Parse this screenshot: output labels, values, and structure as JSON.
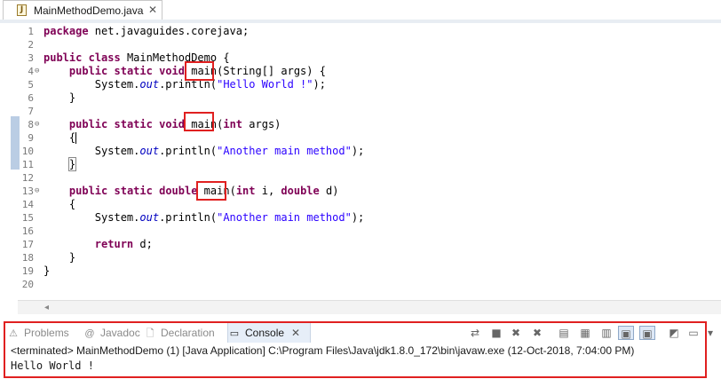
{
  "editor_tab": {
    "title": "MainMethodDemo.java",
    "icon": "java-file-icon",
    "close": "✕"
  },
  "code_lines": [
    {
      "n": "1",
      "html": "<span class=\"kw\">package</span> net.javaguides.corejava;"
    },
    {
      "n": "2",
      "html": ""
    },
    {
      "n": "3",
      "html": "<span class=\"kw\">public</span> <span class=\"kw\">class</span> MainMethodDemo {"
    },
    {
      "n": "4",
      "fold": "⊖",
      "html": "    <span class=\"kw\">public</span> <span class=\"kw\">static</span> <span class=\"kw\">void</span> main(String[] args) {"
    },
    {
      "n": "5",
      "html": "        System.<span class=\"fld\">out</span>.println(<span class=\"str\">\"Hello World !\"</span>);"
    },
    {
      "n": "6",
      "html": "    }"
    },
    {
      "n": "7",
      "html": ""
    },
    {
      "n": "8",
      "fold": "⊖",
      "html": "    <span class=\"kw\">public</span> <span class=\"kw\">static</span> <span class=\"kw\">void</span> main(<span class=\"kw\">int</span> args)"
    },
    {
      "n": "9",
      "html": "    {<span class=\"cursor\"></span>"
    },
    {
      "n": "10",
      "html": "        System.<span class=\"fld\">out</span>.println(<span class=\"str\">\"Another main method\"</span>);"
    },
    {
      "n": "11",
      "html": "    <span class=\"bracket-box\">}</span>"
    },
    {
      "n": "12",
      "html": ""
    },
    {
      "n": "13",
      "fold": "⊖",
      "html": "    <span class=\"kw\">public</span> <span class=\"kw\">static</span> <span class=\"kw\">double</span> main(<span class=\"kw\">int</span> i, <span class=\"kw\">double</span> d)"
    },
    {
      "n": "14",
      "html": "    {"
    },
    {
      "n": "15",
      "html": "        System.<span class=\"fld\">out</span>.println(<span class=\"str\">\"Another main method\"</span>);"
    },
    {
      "n": "16",
      "html": ""
    },
    {
      "n": "17",
      "html": "        <span class=\"kw\">return</span> d;"
    },
    {
      "n": "18",
      "html": "    }"
    },
    {
      "n": "19",
      "html": "}"
    },
    {
      "n": "20",
      "html": ""
    }
  ],
  "console_tabs": [
    {
      "label": "Problems",
      "icon": "problems-icon",
      "glyph": "⚠",
      "active": false
    },
    {
      "label": "Javadoc",
      "icon": "javadoc-icon",
      "glyph": "@",
      "active": false
    },
    {
      "label": "Declaration",
      "icon": "declaration-icon",
      "glyph": "🗋",
      "active": false
    },
    {
      "label": "Console",
      "icon": "console-icon",
      "glyph": "▭",
      "active": true
    }
  ],
  "console_close": "✕",
  "toolbar": [
    {
      "name": "pin-console-icon",
      "glyph": "⇄"
    },
    {
      "name": "terminate-icon",
      "glyph": "■"
    },
    {
      "name": "remove-launch-icon",
      "glyph": "✖"
    },
    {
      "name": "remove-all-terminated-icon",
      "glyph": "✖"
    },
    {
      "name": "clear-console-icon",
      "glyph": "▤"
    },
    {
      "name": "scroll-lock-icon",
      "glyph": "▦"
    },
    {
      "name": "word-wrap-icon",
      "glyph": "▥"
    },
    {
      "name": "show-on-stdout-icon",
      "glyph": "▣",
      "pressed": true
    },
    {
      "name": "show-on-stderr-icon",
      "glyph": "▣",
      "pressed": true
    },
    {
      "name": "open-console-icon",
      "glyph": "◩"
    },
    {
      "name": "display-selected-console-icon",
      "glyph": "▭"
    },
    {
      "name": "view-menu-icon",
      "glyph": "▾"
    }
  ],
  "console": {
    "status": "<terminated> MainMethodDemo (1) [Java Application] C:\\Program Files\\Java\\jdk1.8.0_172\\bin\\javaw.exe (12-Oct-2018, 7:04:00 PM)",
    "output": "Hello World !"
  },
  "colors": {
    "keyword": "#7f0055",
    "string": "#2a00ff",
    "field": "#0000c0",
    "highlight": "#e02020"
  }
}
